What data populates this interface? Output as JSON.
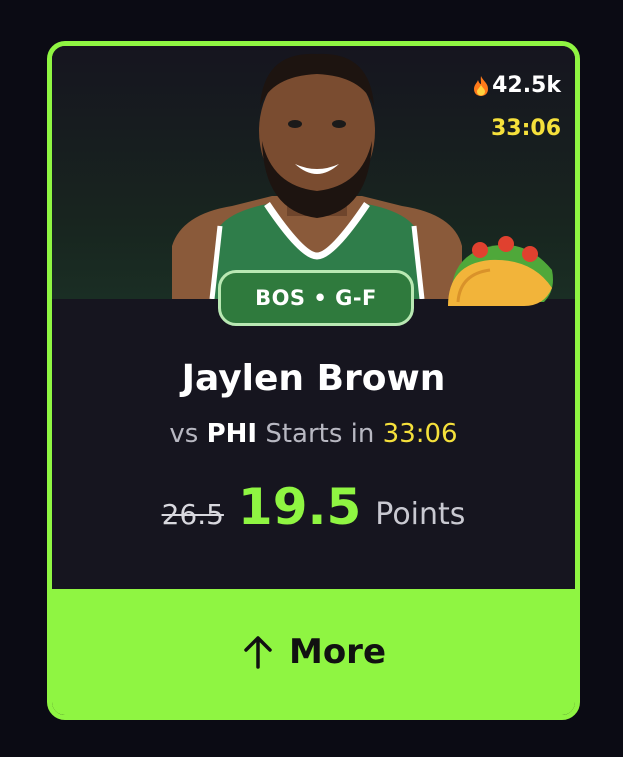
{
  "card": {
    "popularity": "42.5k",
    "timer": "33:06",
    "badge": "BOS • G-F",
    "player_name": "Jaylen Brown",
    "matchup": {
      "prefix": "vs",
      "opponent": "PHI",
      "starts_label": "Starts in",
      "start_time": "33:06"
    },
    "line": {
      "original": "26.5",
      "current": "19.5",
      "stat": "Points"
    },
    "more_button_label": "More"
  },
  "colors": {
    "accent": "#8ff542",
    "timer": "#f5e03b",
    "badge_bg": "#2f7a3d",
    "card_bg": "#16151f"
  },
  "icons": [
    "flame-icon",
    "taco-icon",
    "arrow-up-icon"
  ]
}
